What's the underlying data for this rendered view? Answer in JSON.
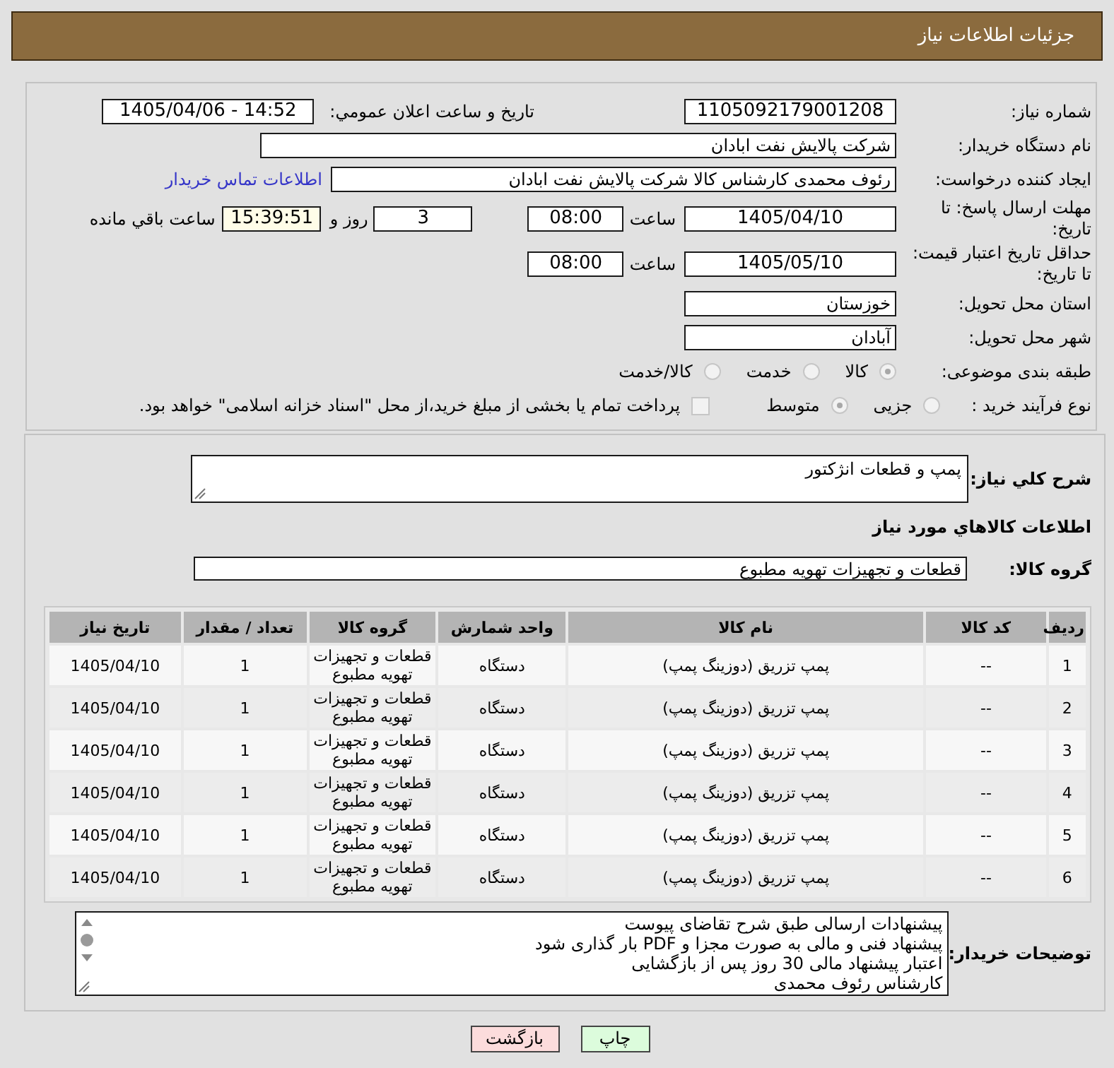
{
  "header": {
    "title": "جزئیات اطلاعات نیاز"
  },
  "details": {
    "need_number": {
      "label": "شماره نیاز:",
      "value": "1105092179001208"
    },
    "announcement": {
      "label": "تاریخ و ساعت اعلان عمومي:",
      "value": "1405/04/06 - 14:52"
    },
    "buyer_org": {
      "label": "نام دستگاه خریدار:",
      "value": "شرکت پالایش نفت ابادان"
    },
    "requester": {
      "label": "ایجاد کننده درخواست:",
      "value": "رئوف محمدی کارشناس کالا شرکت پالایش نفت ابادان",
      "contact_link": "اطلاعات تماس خریدار"
    },
    "reply_deadline": {
      "label": "مهلت ارسال پاسخ: تا تاریخ:",
      "date": "1405/04/10",
      "time_label": "ساعت",
      "time": "08:00",
      "days": "3",
      "days_label": "روز و",
      "remaining": "15:39:51",
      "remaining_label": "ساعت باقي مانده"
    },
    "price_validity": {
      "label": "حداقل تاریخ اعتبار قیمت: تا تاریخ:",
      "date": "1405/05/10",
      "time_label": "ساعت",
      "time": "08:00"
    },
    "province": {
      "label": "استان محل تحویل:",
      "value": "خوزستان"
    },
    "city": {
      "label": "شهر محل تحویل:",
      "value": "آبادان"
    },
    "category": {
      "label": "طبقه بندی موضوعی:",
      "disabled": true,
      "options": [
        {
          "label": "کالا",
          "selected": true
        },
        {
          "label": "خدمت",
          "selected": false
        },
        {
          "label": "کالا/خدمت",
          "selected": false
        }
      ]
    },
    "purchase_process": {
      "label": "نوع فرآیند خرید :",
      "disabled": true,
      "options": [
        {
          "label": "جزیی",
          "selected": false
        },
        {
          "label": "متوسط",
          "selected": true
        }
      ],
      "treasury_payment": {
        "label": "پرداخت تمام یا بخشی از مبلغ خرید،از محل \"اسناد خزانه اسلامی\" خواهد بود.",
        "checked": false,
        "disabled": true
      }
    }
  },
  "summary": {
    "label": "شرح کلي نیاز:",
    "value": "پمپ و قطعات انژکتور"
  },
  "goods_heading": "اطلاعات کالاهاي مورد نیاز",
  "goods_group": {
    "label": "گروه کالا:",
    "value": "قطعات و تجهیزات تهویه مطبوع"
  },
  "table": {
    "columns": [
      "ردیف",
      "کد کالا",
      "نام کالا",
      "واحد شمارش",
      "گروه کالا",
      "تعداد / مقدار",
      "تاریخ نیاز"
    ],
    "rows": [
      [
        "1",
        "--",
        "پمپ تزریق (دوزینگ پمپ)",
        "دستگاه",
        "قطعات و تجهیزات تهویه مطبوع",
        "1",
        "1405/04/10"
      ],
      [
        "2",
        "--",
        "پمپ تزریق (دوزینگ پمپ)",
        "دستگاه",
        "قطعات و تجهیزات تهویه مطبوع",
        "1",
        "1405/04/10"
      ],
      [
        "3",
        "--",
        "پمپ تزریق (دوزینگ پمپ)",
        "دستگاه",
        "قطعات و تجهیزات تهویه مطبوع",
        "1",
        "1405/04/10"
      ],
      [
        "4",
        "--",
        "پمپ تزریق (دوزینگ پمپ)",
        "دستگاه",
        "قطعات و تجهیزات تهویه مطبوع",
        "1",
        "1405/04/10"
      ],
      [
        "5",
        "--",
        "پمپ تزریق (دوزینگ پمپ)",
        "دستگاه",
        "قطعات و تجهیزات تهویه مطبوع",
        "1",
        "1405/04/10"
      ],
      [
        "6",
        "--",
        "پمپ تزریق (دوزینگ پمپ)",
        "دستگاه",
        "قطعات و تجهیزات تهویه مطبوع",
        "1",
        "1405/04/10"
      ]
    ]
  },
  "buyer_notes": {
    "label": "توضیحات خریدار:",
    "lines": [
      "پیشنهادات ارسالی طبق شرح تقاضای پیوست",
      "پیشنهاد فنی و مالی به صورت مجزا و PDF بار گذاری شود",
      "اعتبار پیشنهاد مالی 30 روز پس از بازگشایی",
      "کارشناس رئوف محمدی"
    ]
  },
  "buttons": [
    {
      "label": "چاپ",
      "kind": "print"
    },
    {
      "label": "بازگشت",
      "kind": "back"
    }
  ]
}
